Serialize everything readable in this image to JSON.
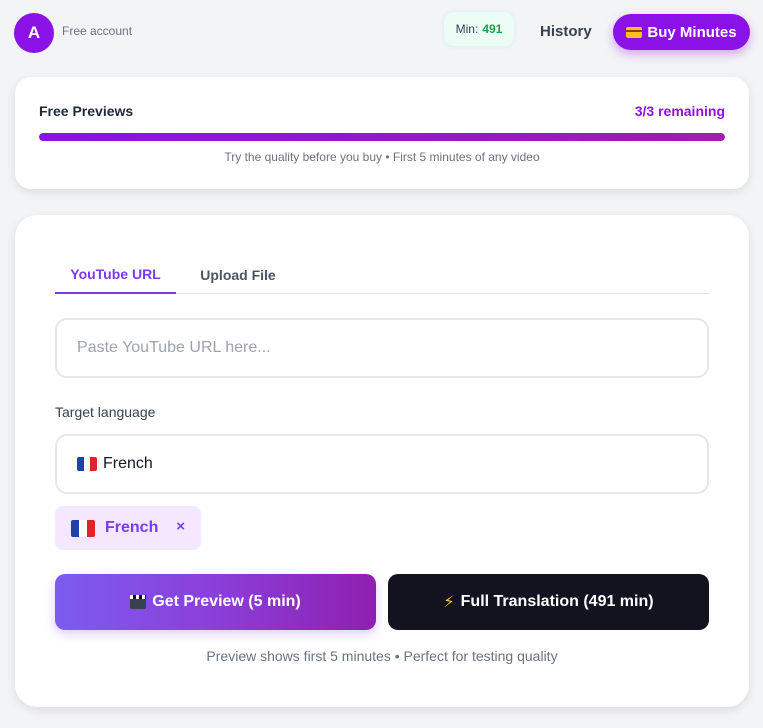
{
  "header": {
    "avatar_letter": "A",
    "account_label": "Free account",
    "minutes_label": "Min:",
    "minutes_value": "491",
    "history_label": "History",
    "buy_label": "Buy Minutes"
  },
  "previews": {
    "title": "Free Previews",
    "remaining": "3/3 remaining",
    "progress_fraction": 1.0,
    "note": "Try the quality before you buy • First 5 minutes of any video"
  },
  "tabs": [
    {
      "label": "YouTube URL",
      "active": true
    },
    {
      "label": "Upload File",
      "active": false
    }
  ],
  "url_input": {
    "placeholder": "Paste YouTube URL here...",
    "value": ""
  },
  "language": {
    "label": "Target language",
    "selected": "French",
    "chips": [
      {
        "label": "French",
        "remove": "×"
      }
    ]
  },
  "actions": {
    "preview_label": "Get Preview (5 min)",
    "full_label": "Full Translation (491 min)"
  },
  "bottom_note": "Preview shows first 5 minutes • Perfect for testing quality",
  "colors": {
    "accent": "#8b12e6",
    "success": "#16a34a",
    "dark_button": "#13131f"
  }
}
